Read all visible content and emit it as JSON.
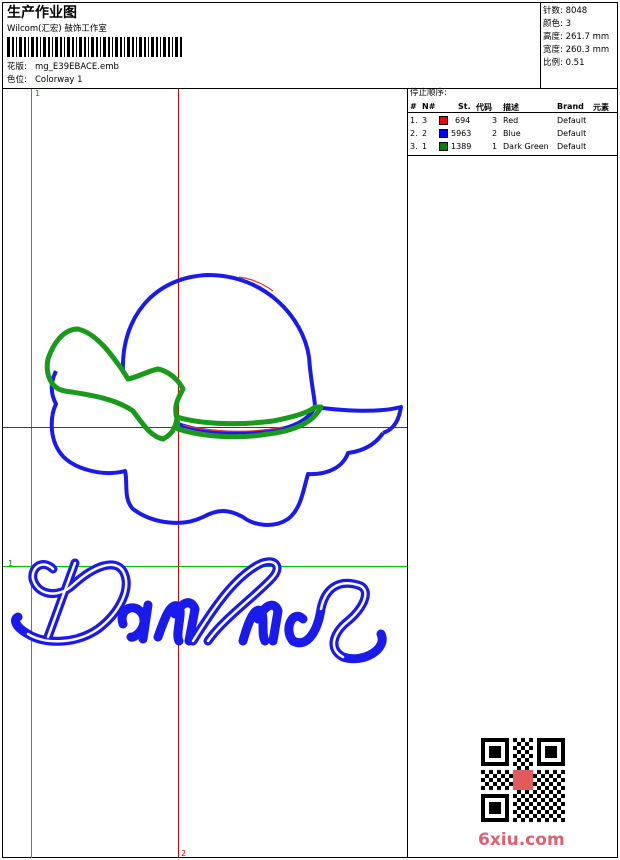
{
  "header": {
    "title": "生产作业图",
    "company": "Wilcom(汇宏) 鼓饰工作室",
    "design_label": "花版:",
    "design_value": "mg_E39EBACE.emb",
    "colorway_label": "色位:",
    "colorway_value": "Colorway 1"
  },
  "stats": {
    "stitches": "针数: 8048",
    "colors": "颜色: 3",
    "height": "高度: 261.7 mm",
    "width": "宽度: 260.3 mm",
    "ratio": "比例: 0.51"
  },
  "stop_sequence": {
    "title": "停止顺序:",
    "headers": [
      "#",
      "N#",
      "St.",
      "代码",
      "描述",
      "Brand",
      "元素"
    ],
    "rows": [
      {
        "idx": "1.",
        "n": "3",
        "color": "#ff0000",
        "stitches": "694",
        "code": "3",
        "desc": "Red",
        "brand": "Default"
      },
      {
        "idx": "2.",
        "n": "2",
        "color": "#0000ff",
        "stitches": "5963",
        "code": "2",
        "desc": "Blue",
        "brand": "Default"
      },
      {
        "idx": "3.",
        "n": "1",
        "color": "#008000",
        "stitches": "1389",
        "code": "1",
        "desc": "Dark Green",
        "brand": "Default"
      }
    ]
  },
  "guides": {
    "green_v": "1",
    "green_h": "1",
    "red_v": "2"
  },
  "design": {
    "text": "Darling",
    "colors": {
      "outline": "#1a1aee",
      "bow": "#1a9a1a",
      "accent": "#dd3333"
    }
  },
  "watermark": "6xiu.com"
}
